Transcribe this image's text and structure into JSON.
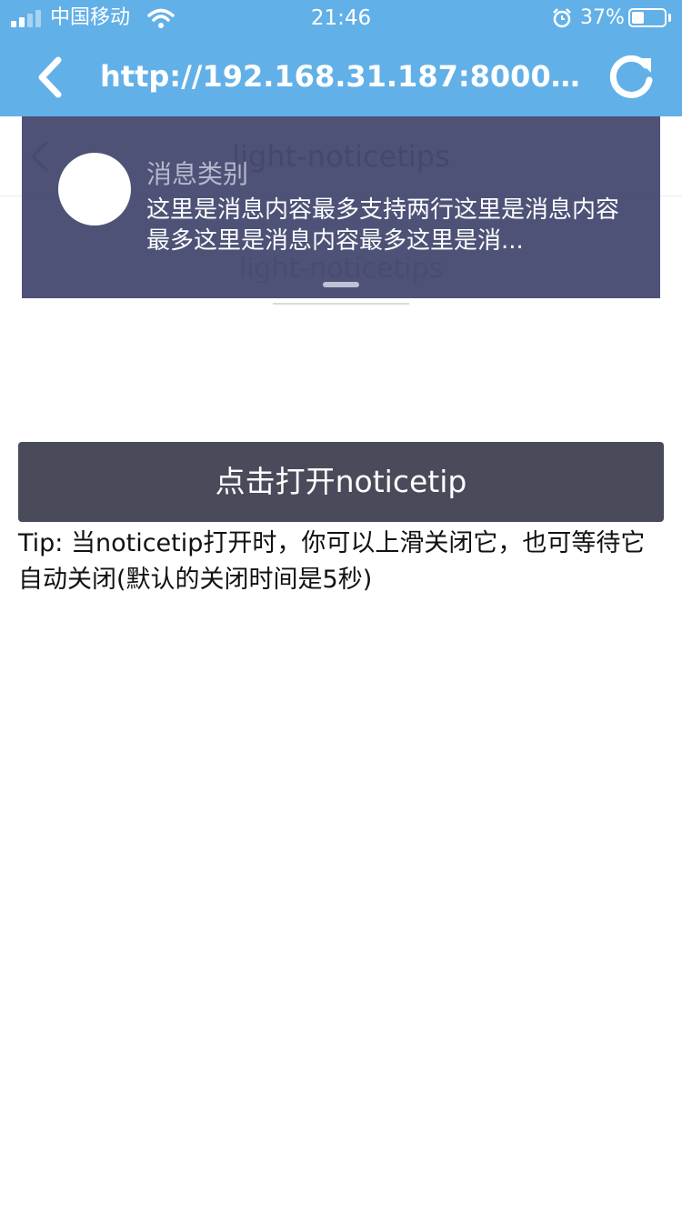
{
  "status_bar": {
    "carrier": "中国移动",
    "time": "21:46",
    "battery": "37%",
    "battery_level": 0.37
  },
  "browser": {
    "url": "http://192.168.31.187:8000/we..."
  },
  "page": {
    "title": "light-noticetips",
    "subtitle": "light-noticetips"
  },
  "noticetip": {
    "category": "消息类别",
    "content": "这里是消息内容最多支持两行这里是消息内容最多这里是消息内容最多这里是消..."
  },
  "main": {
    "open_button": "点击打开noticetip",
    "tip": "Tip: 当noticetip打开时，你可以上滑关闭它，也可等待它自动关闭(默认的关闭时间是5秒)"
  },
  "colors": {
    "browser_bar": "#62b0e8",
    "noticetip_bg": "#444970",
    "button_bg": "#4a4b5a"
  },
  "icons": [
    "signal-icon",
    "wifi-icon",
    "alarm-icon",
    "battery-icon",
    "back-arrow-icon",
    "reload-icon",
    "page-back-icon"
  ]
}
